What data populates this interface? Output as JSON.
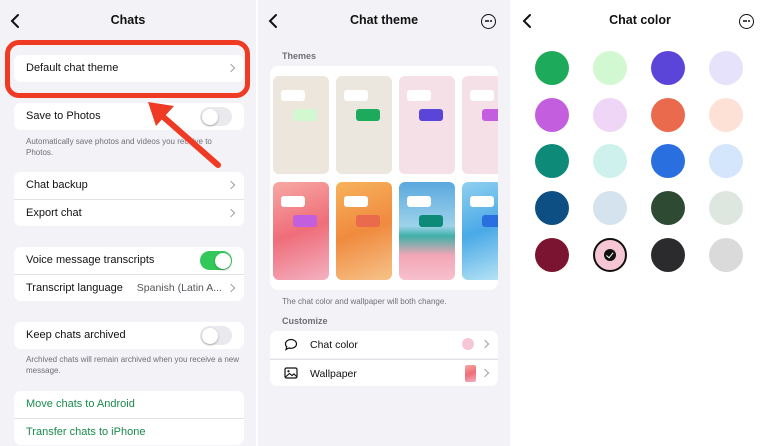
{
  "chats": {
    "title": "Chats",
    "default_chat_theme": "Default chat theme",
    "save_to_photos": "Save to Photos",
    "save_note": "Automatically save photos and videos you receive to Photos.",
    "chat_backup": "Chat backup",
    "export_chat": "Export chat",
    "voice_transcripts": "Voice message transcripts",
    "transcript_language": "Transcript language",
    "transcript_language_value": "Spanish (Latin A...",
    "keep_archived": "Keep chats archived",
    "archived_note": "Archived chats will remain archived when you receive a new message.",
    "move_android": "Move chats to Android",
    "transfer_iphone": "Transfer chats to iPhone",
    "toggles": {
      "save_to_photos": false,
      "voice_transcripts": true,
      "keep_archived": false
    }
  },
  "chat_theme": {
    "title": "Chat theme",
    "themes_label": "Themes",
    "themes_note": "The chat color and wallpaper will both change.",
    "customize_label": "Customize",
    "chat_color": "Chat color",
    "wallpaper": "Wallpaper",
    "current_color": "#f7c6d4"
  },
  "chat_color": {
    "title": "Chat color",
    "colors": [
      "#1daa5a",
      "#d2f8d2",
      "#5b44d8",
      "#e6e2fb",
      "#c35ede",
      "#efd6f6",
      "#e96a4d",
      "#fde1d6",
      "#0e8a78",
      "#cff1ee",
      "#2a6fe0",
      "#d4e6fb",
      "#0d4f82",
      "#d5e3ee",
      "#2f4a32",
      "#dde7df",
      "#7b1430",
      "#f7c6d4",
      "#2b2b2d",
      "#dadadb"
    ],
    "selected_index": 17
  },
  "colors": {
    "highlight": "#ef3b24",
    "green": "#34c759",
    "link_green": "#1b8a4c"
  }
}
